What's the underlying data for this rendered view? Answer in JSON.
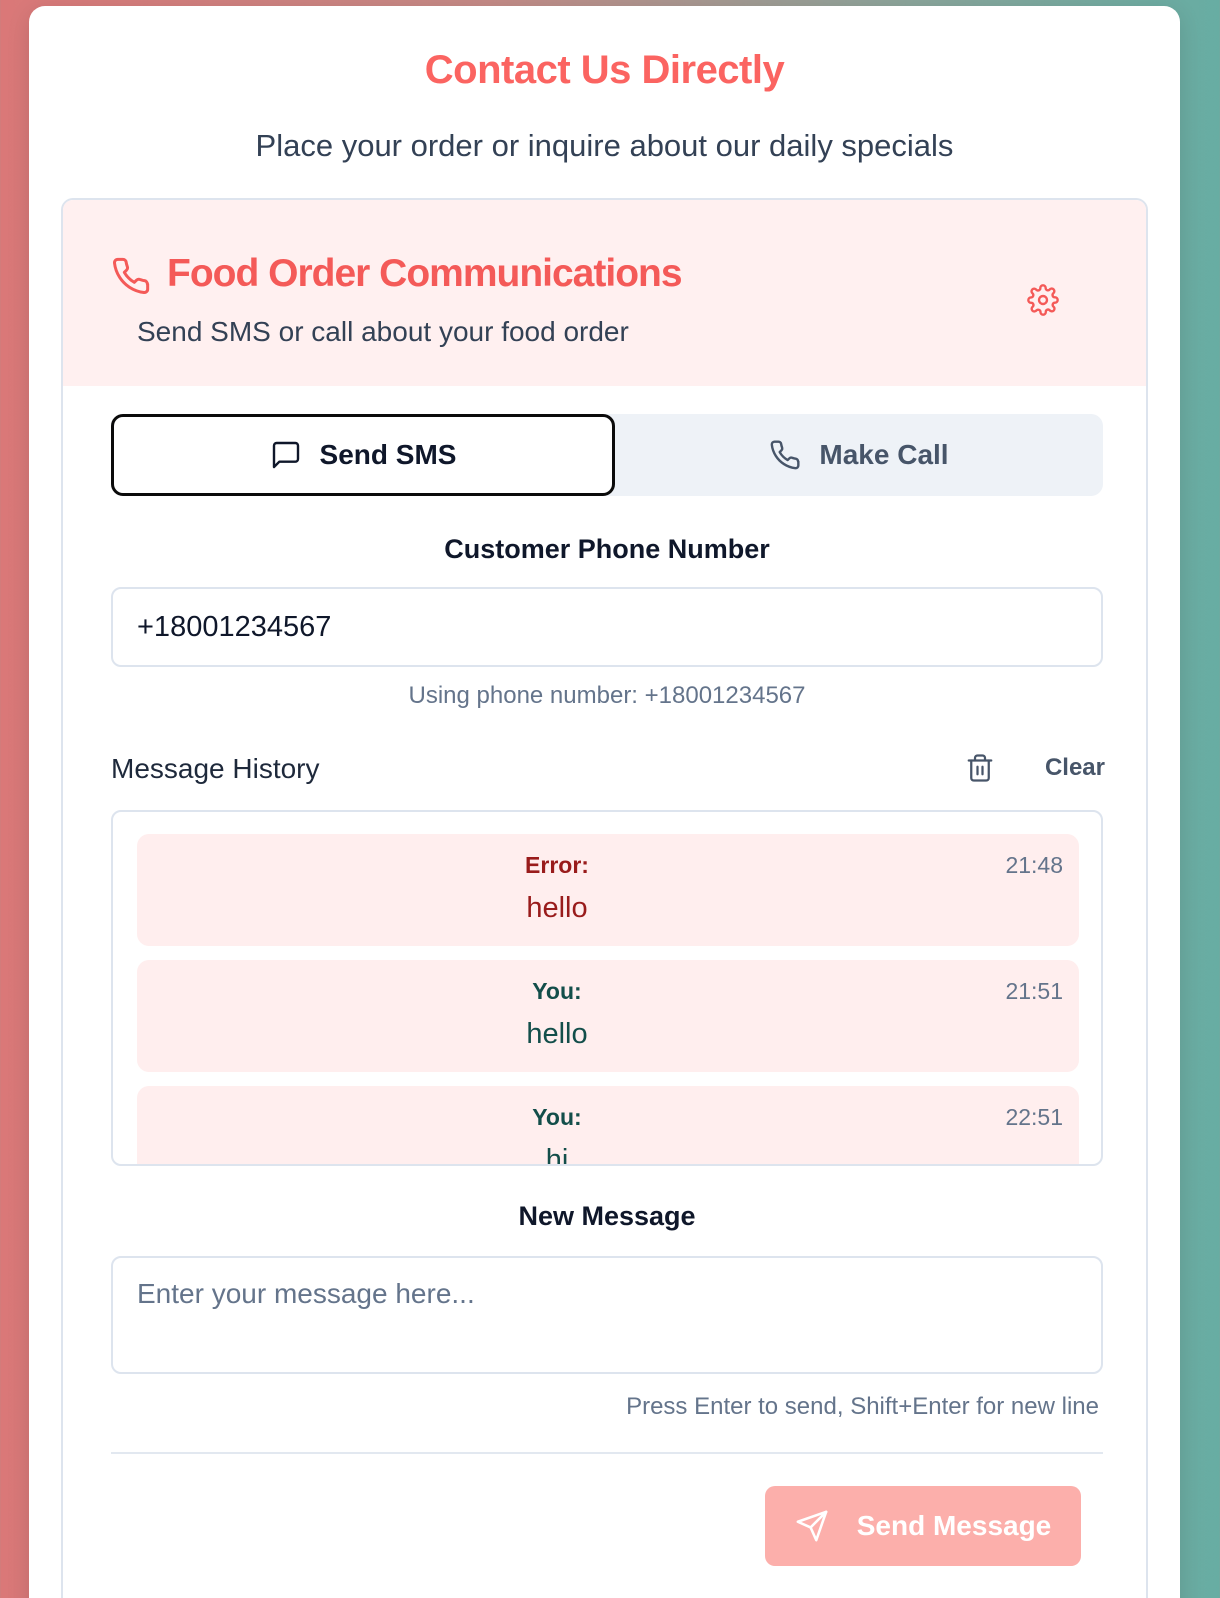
{
  "page": {
    "title": "Contact Us Directly",
    "subtitle": "Place your order or inquire about our daily specials"
  },
  "panel": {
    "title": "Food Order Communications",
    "description": "Send SMS or call about your food order",
    "header_icon": "phone-icon",
    "settings_icon": "gear-icon"
  },
  "tabs": {
    "sms_label": "Send SMS",
    "call_label": "Make Call",
    "active": "Send SMS"
  },
  "phone": {
    "label": "Customer Phone Number",
    "value": "+18001234567",
    "hint": "Using phone number: +18001234567"
  },
  "history": {
    "label": "Message History",
    "clear_label": "Clear",
    "messages": [
      {
        "sender": "Error:",
        "text": "hello",
        "time": "21:48",
        "kind": "error"
      },
      {
        "sender": "You:",
        "text": "hello",
        "time": "21:51",
        "kind": "you"
      },
      {
        "sender": "You:",
        "text": "hi",
        "time": "22:51",
        "kind": "you"
      }
    ]
  },
  "compose": {
    "label": "New Message",
    "placeholder": "Enter your message here...",
    "value": "",
    "hint": "Press Enter to send, Shift+Enter for new line",
    "send_label": "Send Message"
  },
  "colors": {
    "accent": "#fb6461",
    "header_bg": "#fff0f0",
    "send_button_disabled": "#fcafab",
    "error_text": "#991b1b",
    "you_text": "#134e4a"
  }
}
